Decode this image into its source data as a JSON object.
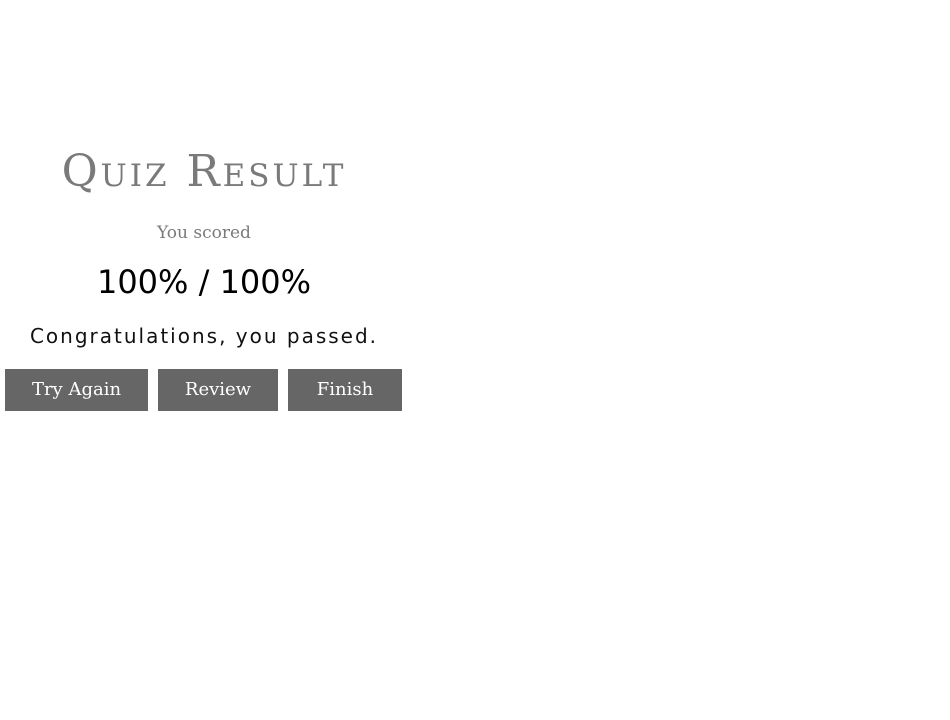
{
  "result": {
    "title": "Quiz Result",
    "scored_label": "You scored",
    "score": "100% / 100%",
    "message": "Congratulations, you passed."
  },
  "buttons": {
    "try_again": "Try Again",
    "review": "Review",
    "finish": "Finish"
  },
  "colors": {
    "button_bg": "#666666",
    "title_text": "#7a7a7a",
    "background": "#ffffff"
  }
}
